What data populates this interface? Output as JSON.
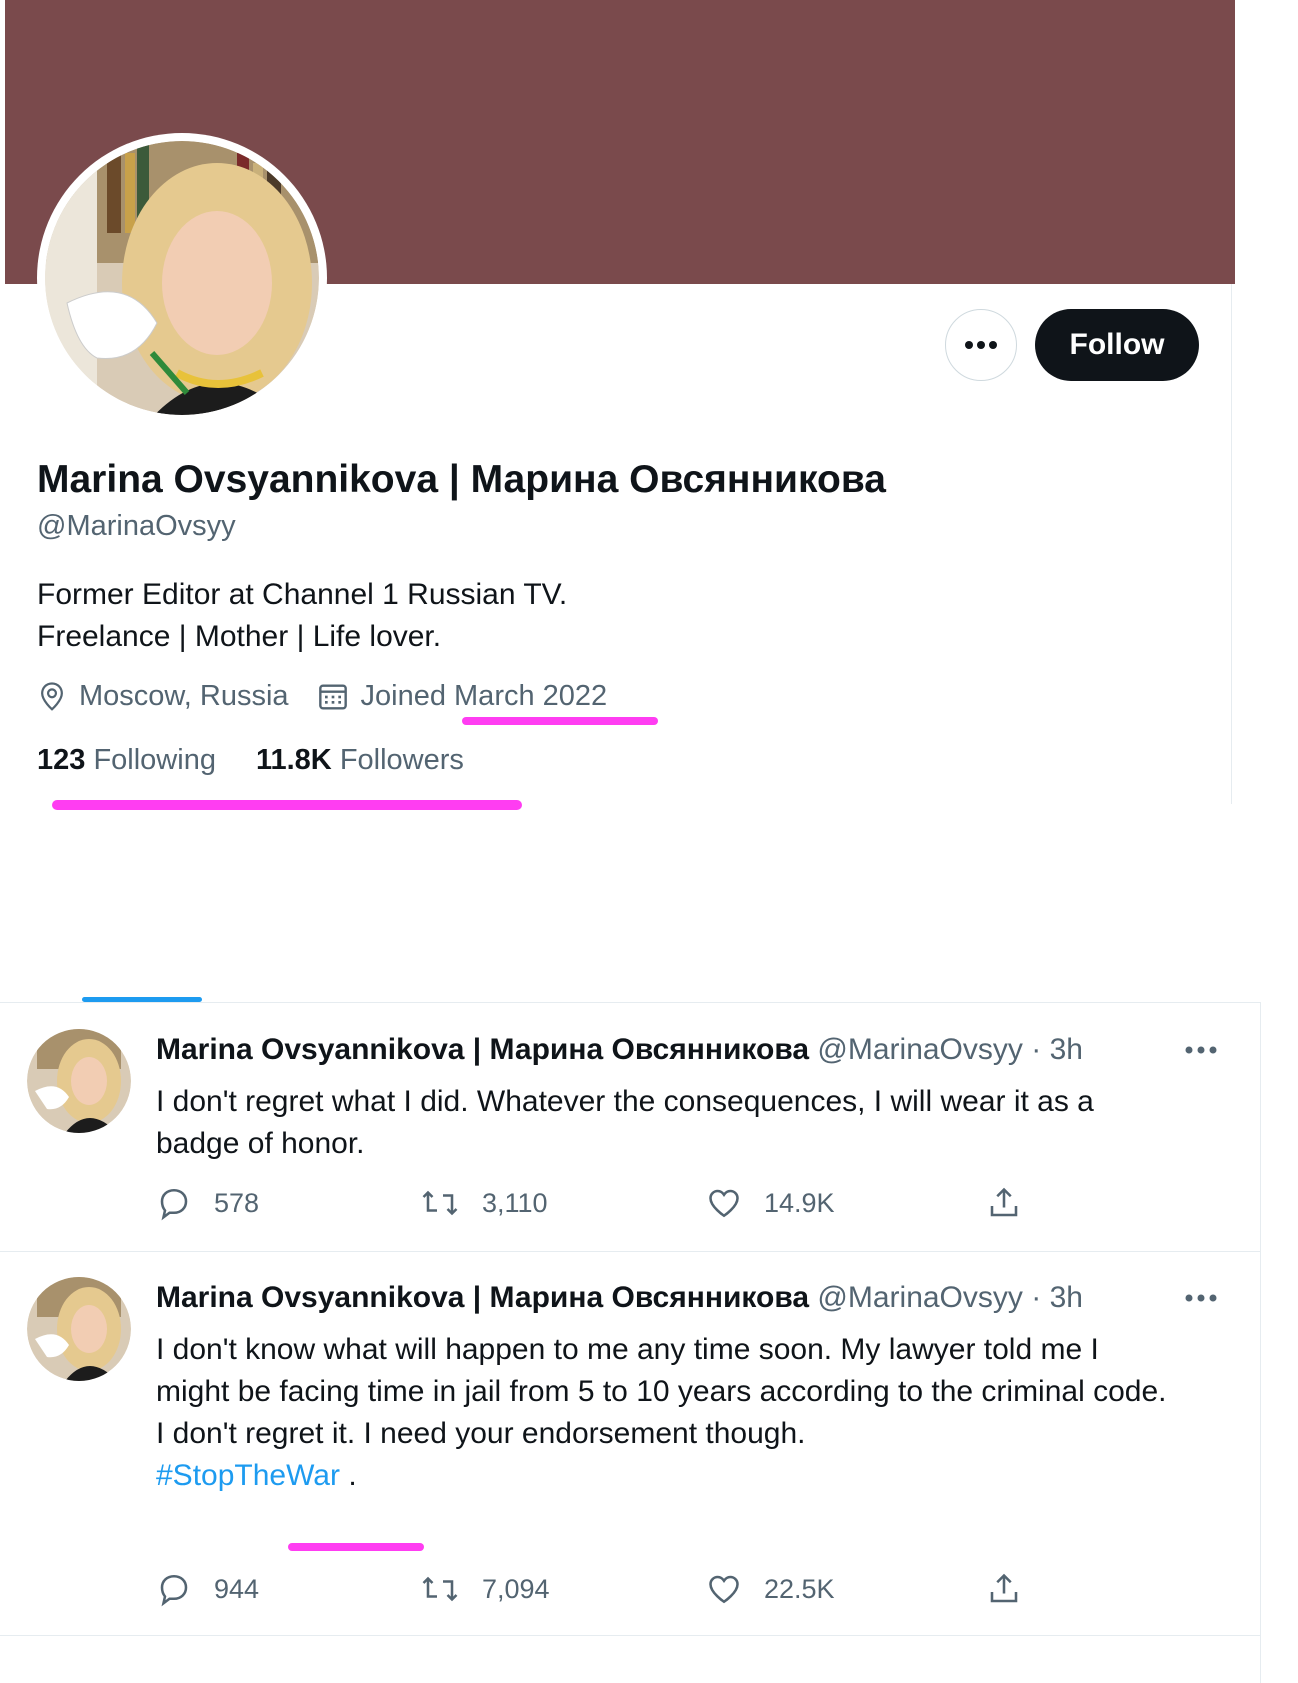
{
  "profile": {
    "display_name": "Marina Ovsyannikova | Марина Овсянникова",
    "handle": "@MarinaOvsyy",
    "bio_line1": "Former Editor at Channel 1 Russian TV.",
    "bio_line2": "Freelance | Mother | Life lover.",
    "location": "Moscow, Russia",
    "joined": "Joined March 2022",
    "following_count": "123",
    "following_label": "Following",
    "followers_count": "11.8K",
    "followers_label": "Followers",
    "follow_button": "Follow",
    "banner_color": "#7a4a4c"
  },
  "tweets": [
    {
      "name": "Marina Ovsyannikova | Марина Овсянникова",
      "handle": "@MarinaOvsyy",
      "time": "· 3h",
      "text": "I don't regret what I did. Whatever the consequences, I will wear it as a badge of honor.",
      "replies": "578",
      "retweets": "3,110",
      "likes": "14.9K"
    },
    {
      "name": "Marina Ovsyannikova | Марина Овсянникова",
      "handle": "@MarinaOvsyy",
      "time": "· 3h",
      "text_line1": "I don't know what will happen to me any time soon. My lawyer told me I might be facing time in jail from 5 to 10 years according to the criminal code.",
      "text_line2": "I don't regret it. I need your endorsement though.",
      "hashtag": "#StopTheWar",
      "trailing": " .",
      "replies": "944",
      "retweets": "7,094",
      "likes": "22.5K"
    }
  ],
  "icons": [
    "more-icon",
    "location-icon",
    "calendar-icon",
    "reply-icon",
    "retweet-icon",
    "like-icon",
    "share-icon"
  ],
  "highlight_color": "#ff3df2",
  "accent_color": "#1d9bf0"
}
